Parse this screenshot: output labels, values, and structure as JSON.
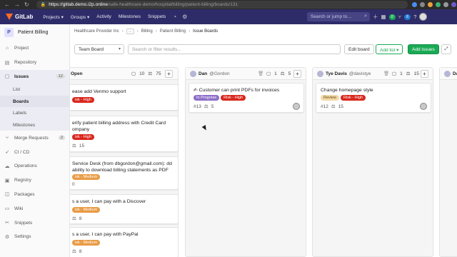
{
  "browser": {
    "url_host": "https://gitlab.demo.i2p.online",
    "url_path": "/safe-healthcare-demo/hospital/billing/patient-billing/boards/131"
  },
  "topnav": {
    "brand": "GitLab",
    "menu": [
      "Projects ▾",
      "Groups ▾",
      "Activity",
      "Milestones",
      "Snippets"
    ],
    "search_placeholder": "Search or jump to…",
    "search_shortcut": "⌕",
    "badge_mr": "0",
    "badge_todo": "6"
  },
  "sidebar": {
    "project_avatar": "P",
    "project_name": "Patient Billing",
    "items": [
      {
        "label": "Project",
        "icon": "home-icon"
      },
      {
        "label": "Repository",
        "icon": "book-icon"
      },
      {
        "label": "Issues",
        "icon": "issues-icon",
        "count": "12"
      },
      {
        "label": "Merge Requests",
        "icon": "merge-icon",
        "count": "2"
      },
      {
        "label": "CI / CD",
        "icon": "rocket-icon"
      },
      {
        "label": "Operations",
        "icon": "cloud-icon"
      },
      {
        "label": "Registry",
        "icon": "box-icon"
      },
      {
        "label": "Packages",
        "icon": "package-icon"
      },
      {
        "label": "Wiki",
        "icon": "wiki-icon"
      },
      {
        "label": "Snippets",
        "icon": "scissors-icon"
      },
      {
        "label": "Settings",
        "icon": "gear-icon"
      }
    ],
    "issues_sub": [
      "List",
      "Boards",
      "Labels",
      "Milestones"
    ]
  },
  "breadcrumb": {
    "items": [
      "Healthcare Provider Inc",
      "…",
      "Billing",
      "Patient Billing",
      "Issue Boards"
    ]
  },
  "toolbar": {
    "board_name": "Team Board",
    "filter_placeholder": "Search or filter results...",
    "edit_board": "Edit board",
    "add_list": "Add list ▾",
    "add_issues": "Add issues"
  },
  "lists": [
    {
      "title": "Open",
      "issues": "10",
      "weight": "75",
      "cards": [
        {
          "title": "ease add Venmo support",
          "labels": [
            {
              "text": "isk - High",
              "type": "high"
            }
          ],
          "ref": "",
          "weight": ""
        },
        {
          "title": "erify patient billing address with Credit Card ompany",
          "labels": [
            {
              "text": "isk - High",
              "type": "high"
            }
          ],
          "ref": "",
          "weight": "15"
        },
        {
          "title": "Service Desk (from dbgordon@gmail.com): dd ability to download billing statements as PDF",
          "labels": [
            {
              "text": "isk - Medium",
              "type": "med"
            }
          ],
          "ref": "0",
          "weight": ""
        },
        {
          "title": "s a user, I can pay with a Discover",
          "labels": [
            {
              "text": "isk - Medium",
              "type": "med"
            }
          ],
          "ref": "",
          "weight": "8"
        },
        {
          "title": "s a user, I can pay with PayPal",
          "labels": [
            {
              "text": "isk - Medium",
              "type": "med"
            }
          ],
          "ref": "",
          "weight": "8"
        }
      ]
    },
    {
      "title": "Dan",
      "handle": "@Gordon",
      "issues": "1",
      "weight": "5",
      "cards": [
        {
          "title": "✍ Customer can print PDFs for invoices",
          "labels": [
            {
              "text": "In Progress",
              "type": "prog"
            },
            {
              "text": "Risk - High",
              "type": "high"
            }
          ],
          "ref": "#13",
          "weight": "5"
        }
      ]
    },
    {
      "title": "Tye Davis",
      "handle": "@davistye",
      "issues": "1",
      "weight": "15",
      "cards": [
        {
          "title": "Change homepage style",
          "labels": [
            {
              "text": "Review",
              "type": "rev"
            },
            {
              "text": "Risk - High",
              "type": "high"
            }
          ],
          "ref": "#12",
          "weight": "15"
        }
      ]
    },
    {
      "title": "Da",
      "handle": "",
      "issues": "",
      "weight": "",
      "cards": []
    }
  ]
}
